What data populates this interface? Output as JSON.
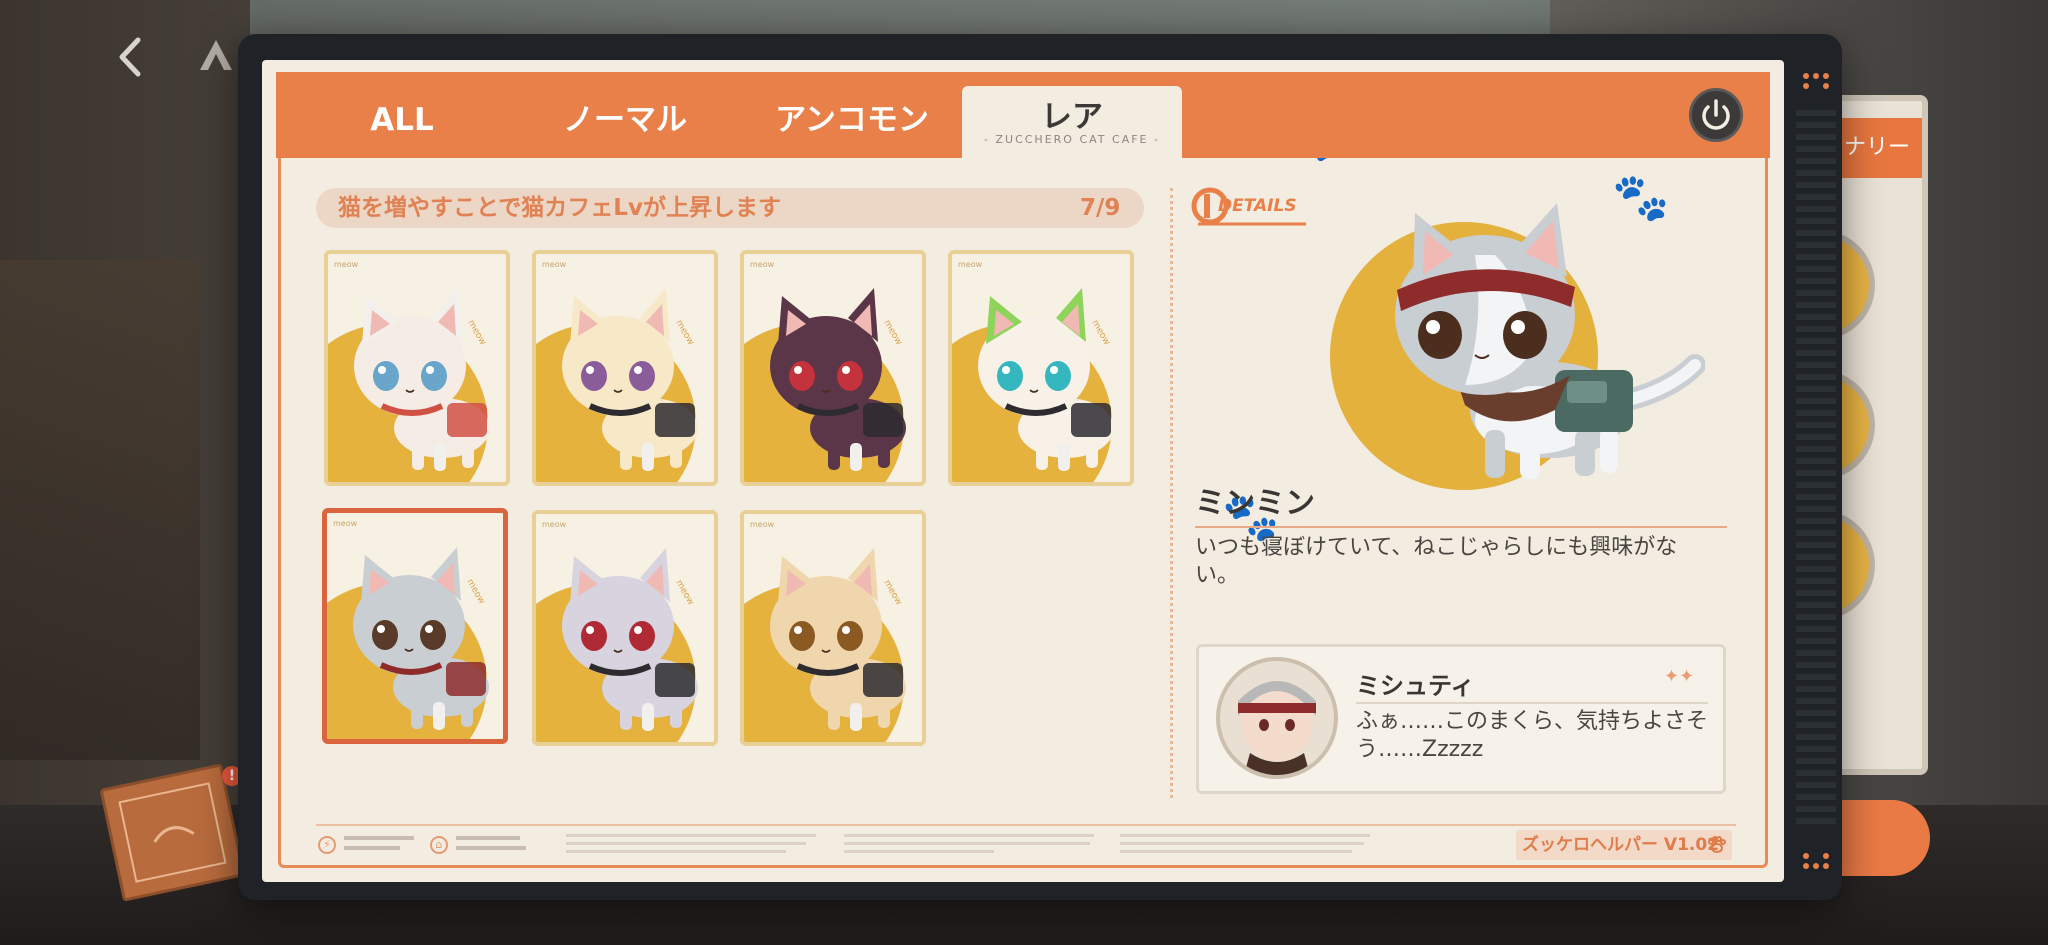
{
  "tabs": [
    {
      "label": "ALL",
      "active": false
    },
    {
      "label": "ノーマル",
      "active": false
    },
    {
      "label": "アンコモン",
      "active": false
    },
    {
      "label": "レア",
      "active": true
    }
  ],
  "active_tab_subtitle": "- ZUCCHERO CAT CAFE -",
  "info": {
    "text": "猫を増やすことで猫カフェLvが上昇します",
    "count": "7/9"
  },
  "cards": [
    {
      "card_label": "meow",
      "fur": "#f6ece6",
      "ear": "#f2f0ec",
      "eye": "#6aa6c9",
      "accent": "#d05144"
    },
    {
      "card_label": "meow",
      "fur": "#f7e8c8",
      "ear": "#f7e8c8",
      "eye": "#8a5c9a",
      "accent": "#2d2b30"
    },
    {
      "card_label": "meow",
      "fur": "#5a3648",
      "ear": "#5a3648",
      "eye": "#c4323c",
      "accent": "#2d2b30"
    },
    {
      "card_label": "meow",
      "fur": "#f7f1e8",
      "ear": "#8ed35a",
      "eye": "#35b7bf",
      "accent": "#2d2b30"
    },
    {
      "card_label": "meow",
      "fur": "#c9ced3",
      "ear": "#c9ced3",
      "eye": "#5a3a28",
      "accent": "#8e2c2c"
    },
    {
      "card_label": "meow",
      "fur": "#d7d3df",
      "ear": "#d7d3df",
      "eye": "#b02a36",
      "accent": "#2d2b30"
    },
    {
      "card_label": "meow",
      "fur": "#f0d6ad",
      "ear": "#f0d6ad",
      "eye": "#8a5a22",
      "accent": "#2d2b30"
    }
  ],
  "selected_card": 4,
  "details": {
    "logo_text": "DETAILS",
    "name": "ミンミン",
    "description": "いつも寝ぼけていて、ねこじゃらしにも興味がない。",
    "quote": {
      "speaker": "ミシュティ",
      "sparkle": "✦✦",
      "text": "ふぁ……このまくら、気持ちよさそう……Zzzzz"
    }
  },
  "side_panel": {
    "tab_label": "ナリー"
  },
  "book": {
    "alert": "!"
  },
  "footer": {
    "icon1": "⚡",
    "icon2": "⌂",
    "version": "ズッケロヘルパー V1.02"
  },
  "icons": {
    "back": "back-chevron-icon",
    "power": "power-icon",
    "paw": "paw-icon"
  },
  "colors": {
    "accent": "#e9804a",
    "panel": "#f3ece1",
    "card_gold": "#e6b23e",
    "frame": "#1f2327"
  }
}
